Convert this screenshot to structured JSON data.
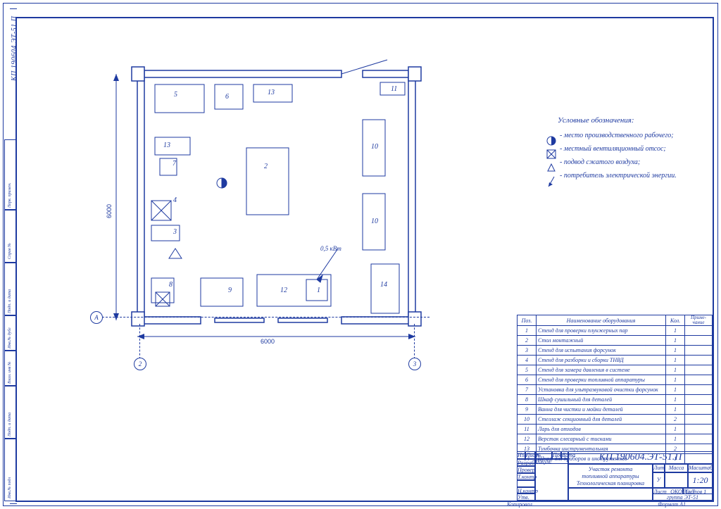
{
  "drawing_number": "КП.190604.ЭТ-51.П",
  "drawing_number_rot": "КП.190604.ЭТ-51.П",
  "title_l1": "Участок ремонта",
  "title_l2": "топливной аппаратуры",
  "title_l3": "Технологическая планировка",
  "scale": "1:20",
  "org_l1": "ОКОТСиТ",
  "org_l2": "группа ЭТ-51",
  "sheet_format": "Формат   А1",
  "kopirovat": "Копировал",
  "tb_cols": {
    "lit": "Лит",
    "u": "У",
    "mass": "Масса",
    "mash": "Масштаб",
    "list": "Лист",
    "listov": "Листов  1"
  },
  "tb_rows": {
    "izm": "Изм",
    "list": "Лист",
    "ndoc": "№ докум.",
    "podp": "Подп.",
    "data": "Дата",
    "razrab": "Разраб",
    "prov": "Провер",
    "tkontr": "Т.контр",
    "nkontr": "Н.контр",
    "utv": "Утв."
  },
  "side_labels": {
    "spravN": "Справ №",
    "pervprim": "Перв. примен.",
    "podpdata": "Подп. и дата",
    "invdubl": "Инв.№ дубл",
    "vzinv": "Взам. инв №",
    "podpdata2": "Подп. и дата",
    "invpod": "Инв.№ подл"
  },
  "dims": {
    "w": "6000",
    "h": "6000",
    "power": "0,5 кВт"
  },
  "axes": {
    "A": "А",
    "2": "2",
    "3": "3"
  },
  "legend": {
    "title": "Условные обозначения:",
    "items": [
      {
        "sym": "circle_half",
        "text": "- место производственного рабочего;"
      },
      {
        "sym": "box_x",
        "text": "- местный вентиляционный отсос;"
      },
      {
        "sym": "triangle",
        "text": "- подвод сжатого воздуха;"
      },
      {
        "sym": "arrow",
        "text": "- потребитель электрической энергии."
      }
    ]
  },
  "spec": {
    "headers": {
      "poz": "Поз.",
      "name": "Наименование оборудования",
      "kol": "Кол.",
      "prim": "Приме-\nчание"
    },
    "rows": [
      {
        "p": "1",
        "n": "Стенд для проверки плунжерных пар",
        "k": "1"
      },
      {
        "p": "2",
        "n": "Стол монтажный",
        "k": "1"
      },
      {
        "p": "3",
        "n": "Стенд для испытания форсунок",
        "k": "1"
      },
      {
        "p": "4",
        "n": "Стенд для разборки и сборки ТНВД",
        "k": "1"
      },
      {
        "p": "5",
        "n": "Стенд для замера давления в системе",
        "k": "1"
      },
      {
        "p": "6",
        "n": "Стенд для проверки топливной аппаратуры",
        "k": "1"
      },
      {
        "p": "7",
        "n": "Установка для ультразвуковой очистки форсунок",
        "k": "1"
      },
      {
        "p": "8",
        "n": "Шкаф сушильный для деталей",
        "k": "1"
      },
      {
        "p": "9",
        "n": "Ванна для чистки и мойки деталей",
        "k": "1"
      },
      {
        "p": "10",
        "n": "Стеллаж секционный для деталей",
        "k": "2"
      },
      {
        "p": "11",
        "n": "Ларь для отходов",
        "k": "1"
      },
      {
        "p": "12",
        "n": "Верстак слесарный с тисками",
        "k": "1"
      },
      {
        "p": "13",
        "n": "Тумбочка инструментальная",
        "k": "2"
      },
      {
        "p": "14",
        "n": "Шкаф для приборов и инструментов",
        "k": "1"
      }
    ]
  },
  "equip": {
    "1": "1",
    "2": "2",
    "3": "3",
    "4": "4",
    "5": "5",
    "6": "6",
    "7": "7",
    "8": "8",
    "9": "9",
    "10": "10",
    "11": "11",
    "12": "12",
    "13a": "13",
    "13b": "13",
    "14": "14"
  }
}
